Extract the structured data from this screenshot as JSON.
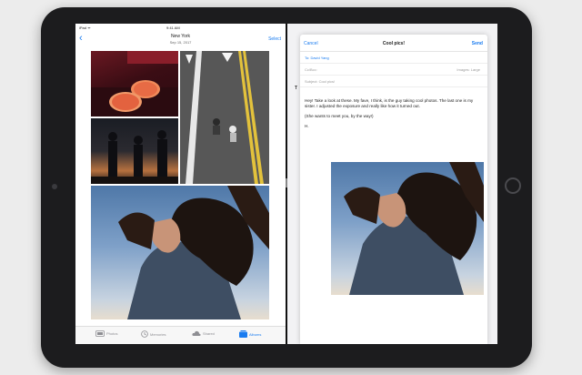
{
  "status_bar": {
    "left": "iPad ᯤ",
    "time": "9:41 AM"
  },
  "photos_nav": {
    "back_glyph": "‹",
    "title": "New York",
    "subtitle": "Sep 15, 2017",
    "select_label": "Select"
  },
  "tab_bar": {
    "items": [
      {
        "label": "Photos",
        "icon": "photos-icon"
      },
      {
        "label": "Memories",
        "icon": "memories-icon"
      },
      {
        "label": "Shared",
        "icon": "cloud-icon"
      },
      {
        "label": "Albums",
        "icon": "albums-icon"
      }
    ],
    "active_index": 3
  },
  "mail": {
    "cancel_label": "Cancel",
    "title": "Cool pics!",
    "send_label": "Send",
    "to_value": "To: David Yang",
    "cc_label": "Cc/Bcc:",
    "subject_value": "Subject: Cool pics!",
    "images_label": "Images: Large",
    "body_p1": "Hey! Take a look at these. My fave, I think, is the guy taking cool photos. The last one is my sister. I adjusted the exposure and really like how it turned out.",
    "body_p2": "(She wants to meet you, by the way!)",
    "body_p3": "H."
  },
  "background_app": {
    "partial_letter": "T"
  },
  "colors": {
    "accent": "#1a7cf0",
    "device": "#1c1c1e",
    "background": "#ececec"
  }
}
